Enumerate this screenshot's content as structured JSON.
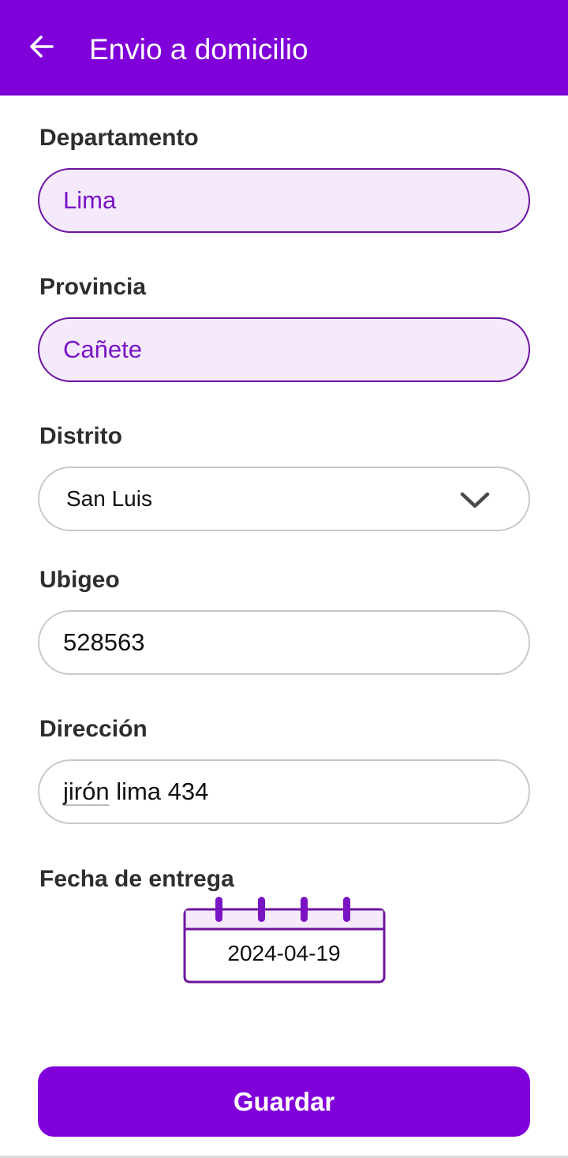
{
  "appbar": {
    "title": "Envio a domicilio",
    "back_icon": "arrow-left-icon",
    "color": "#8000d9"
  },
  "form": {
    "departamento": {
      "label": "Departamento",
      "value": "Lima"
    },
    "provincia": {
      "label": "Provincia",
      "value": "Cañete"
    },
    "distrito": {
      "label": "Distrito",
      "value": "San Luis",
      "icon": "chevron-down-icon"
    },
    "ubigeo": {
      "label": "Ubigeo",
      "value": "528563"
    },
    "direccion": {
      "label": "Dirección",
      "value_word1": "jirón",
      "value_rest": " lima 434"
    },
    "fecha": {
      "label": "Fecha de entrega",
      "value": "2024-04-19",
      "icon": "calendar-icon"
    }
  },
  "actions": {
    "save_label": "Guardar"
  },
  "colors": {
    "accent": "#8000d9",
    "readonly_fill": "#f4eafc",
    "readonly_border": "#6e14a0",
    "readonly_text": "#7a13c4"
  }
}
